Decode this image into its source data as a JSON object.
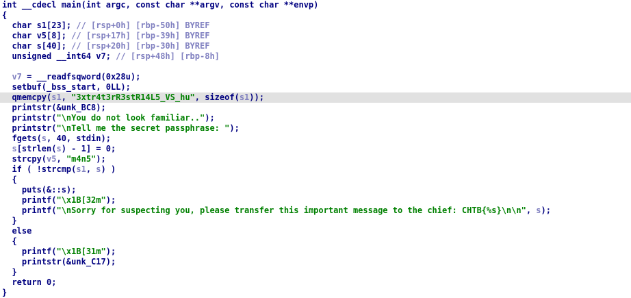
{
  "code_view": {
    "lines": [
      {
        "segments": [
          {
            "t": "int __cdecl main(int argc, const char **argv, const char **envp)",
            "c": "kw"
          }
        ]
      },
      {
        "segments": [
          {
            "t": "{",
            "c": "kw"
          }
        ]
      },
      {
        "segments": [
          {
            "t": "  char s1[23]; ",
            "c": "kw"
          },
          {
            "t": "// [rsp+0h] [rbp-50h] BYREF",
            "c": "cm"
          }
        ]
      },
      {
        "segments": [
          {
            "t": "  char v5[8]; ",
            "c": "kw"
          },
          {
            "t": "// [rsp+17h] [rbp-39h] BYREF",
            "c": "cm"
          }
        ]
      },
      {
        "segments": [
          {
            "t": "  char s[40]; ",
            "c": "kw"
          },
          {
            "t": "// [rsp+20h] [rbp-30h] BYREF",
            "c": "cm"
          }
        ]
      },
      {
        "segments": [
          {
            "t": "  unsigned __int64 v7; ",
            "c": "kw"
          },
          {
            "t": "// [rsp+48h] [rbp-8h]",
            "c": "cm"
          }
        ]
      },
      {
        "segments": [
          {
            "t": "",
            "c": "kw"
          }
        ]
      },
      {
        "segments": [
          {
            "t": "  v7",
            "c": "var"
          },
          {
            "t": " = __readfsqword(0x28u);",
            "c": "kw"
          }
        ]
      },
      {
        "segments": [
          {
            "t": "  setbuf(_bss_start, 0LL);",
            "c": "kw"
          }
        ]
      },
      {
        "highlight": true,
        "segments": [
          {
            "t": "  qmemcpy(",
            "c": "kw"
          },
          {
            "t": "s1",
            "c": "var"
          },
          {
            "t": ", ",
            "c": "kw"
          },
          {
            "t": "\"3xtr4t3rR3stR14L5_VS_hu\"",
            "c": "str"
          },
          {
            "t": ", sizeof(",
            "c": "kw"
          },
          {
            "t": "s1",
            "c": "var"
          },
          {
            "t": "));",
            "c": "kw"
          }
        ]
      },
      {
        "segments": [
          {
            "t": "  printstr(&unk_BC8);",
            "c": "kw"
          }
        ]
      },
      {
        "segments": [
          {
            "t": "  printstr(",
            "c": "kw"
          },
          {
            "t": "\"\\nYou do not look familiar..\"",
            "c": "str"
          },
          {
            "t": ");",
            "c": "kw"
          }
        ]
      },
      {
        "segments": [
          {
            "t": "  printstr(",
            "c": "kw"
          },
          {
            "t": "\"\\nTell me the secret passphrase: \"",
            "c": "str"
          },
          {
            "t": ");",
            "c": "kw"
          }
        ]
      },
      {
        "segments": [
          {
            "t": "  fgets(",
            "c": "kw"
          },
          {
            "t": "s",
            "c": "var"
          },
          {
            "t": ", 40, stdin);",
            "c": "kw"
          }
        ]
      },
      {
        "segments": [
          {
            "t": "  s",
            "c": "var"
          },
          {
            "t": "[strlen(",
            "c": "kw"
          },
          {
            "t": "s",
            "c": "var"
          },
          {
            "t": ") - 1] = 0;",
            "c": "kw"
          }
        ]
      },
      {
        "segments": [
          {
            "t": "  strcpy(",
            "c": "kw"
          },
          {
            "t": "v5",
            "c": "var"
          },
          {
            "t": ", ",
            "c": "kw"
          },
          {
            "t": "\"m4n5\"",
            "c": "str"
          },
          {
            "t": ");",
            "c": "kw"
          }
        ]
      },
      {
        "segments": [
          {
            "t": "  if ( !strcmp(",
            "c": "kw"
          },
          {
            "t": "s1",
            "c": "var"
          },
          {
            "t": ", ",
            "c": "kw"
          },
          {
            "t": "s",
            "c": "var"
          },
          {
            "t": ") )",
            "c": "kw"
          }
        ]
      },
      {
        "segments": [
          {
            "t": "  {",
            "c": "kw"
          }
        ]
      },
      {
        "segments": [
          {
            "t": "    puts(&::s);",
            "c": "kw"
          }
        ]
      },
      {
        "segments": [
          {
            "t": "    printf(",
            "c": "kw"
          },
          {
            "t": "\"\\x1B[32m\"",
            "c": "str"
          },
          {
            "t": ");",
            "c": "kw"
          }
        ]
      },
      {
        "segments": [
          {
            "t": "    printf(",
            "c": "kw"
          },
          {
            "t": "\"\\nSorry for suspecting you, please transfer this important message to the chief: CHTB{%s}\\n\\n\"",
            "c": "str"
          },
          {
            "t": ", ",
            "c": "kw"
          },
          {
            "t": "s",
            "c": "var"
          },
          {
            "t": ");",
            "c": "kw"
          }
        ]
      },
      {
        "segments": [
          {
            "t": "  }",
            "c": "kw"
          }
        ]
      },
      {
        "segments": [
          {
            "t": "  else",
            "c": "kw"
          }
        ]
      },
      {
        "segments": [
          {
            "t": "  {",
            "c": "kw"
          }
        ]
      },
      {
        "segments": [
          {
            "t": "    printf(",
            "c": "kw"
          },
          {
            "t": "\"\\x1B[31m\"",
            "c": "str"
          },
          {
            "t": ");",
            "c": "kw"
          }
        ]
      },
      {
        "segments": [
          {
            "t": "    printstr(&unk_C17);",
            "c": "kw"
          }
        ]
      },
      {
        "segments": [
          {
            "t": "  }",
            "c": "kw"
          }
        ]
      },
      {
        "segments": [
          {
            "t": "  return 0;",
            "c": "kw"
          }
        ]
      },
      {
        "segments": [
          {
            "t": "}",
            "c": "kw"
          }
        ]
      }
    ]
  },
  "colors": {
    "keyword": "#000080",
    "variable": "#8080c0",
    "string": "#008000",
    "highlight_line": "#e1e1e1",
    "background": "#ffffff"
  }
}
